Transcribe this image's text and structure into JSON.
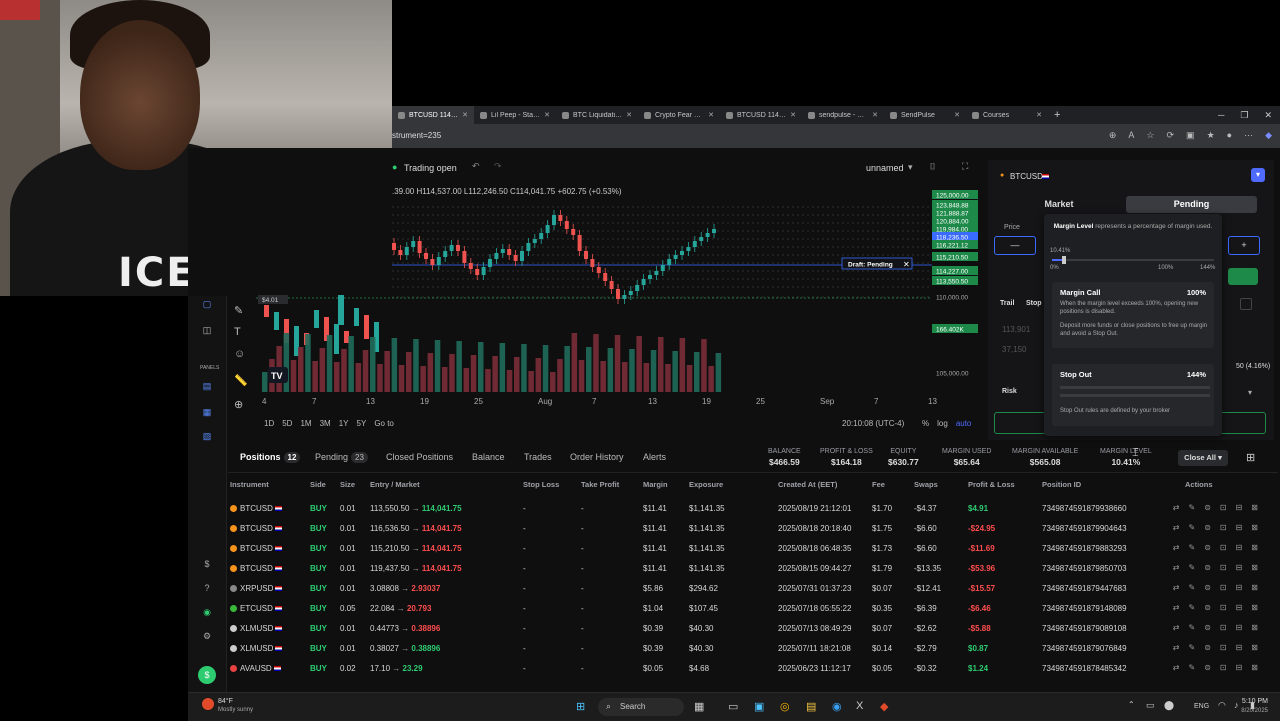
{
  "browser": {
    "tabs": [
      {
        "label": "BTCUSD 114,041.75",
        "active": true
      },
      {
        "label": "Lil Peep - Star Shopping"
      },
      {
        "label": "BTC Liquidation Levels"
      },
      {
        "label": "Crypto Fear & Greed"
      },
      {
        "label": "BTCUSD 114,147"
      },
      {
        "label": "sendpulse - Search"
      },
      {
        "label": "SendPulse"
      },
      {
        "label": "Courses"
      }
    ],
    "new_tab": "+",
    "url": "strument=235"
  },
  "chart": {
    "status": "Trading open",
    "layout_name": "unnamed",
    "ohlc": ".39.00 H114,537.00 L112,246.50 C114,041.75 +602.75 (+0.53%)",
    "draft_label": "Draft: Pending",
    "price_labels": [
      "125,000.00",
      "123,848.88",
      "121,888.87",
      "120,884.00",
      "119,984.00",
      "118,236.50",
      "116,221.12",
      "115,210.50",
      "114,227.00",
      "113,550.50",
      "110,000.00",
      "166.402K",
      "105,000.00"
    ],
    "small_tag": "$4.01",
    "x_labels": [
      "4",
      "7",
      "13",
      "19",
      "25",
      "Aug",
      "7",
      "13",
      "19",
      "25",
      "Sep",
      "7",
      "13"
    ],
    "periods": [
      "1D",
      "5D",
      "1M",
      "3M",
      "1Y",
      "5Y",
      "Go to"
    ],
    "clock": "20:10:08 (UTC-4)",
    "scale_opts": [
      "%",
      "log",
      "auto"
    ]
  },
  "chart_data": {
    "type": "candlestick",
    "title": "BTCUSD",
    "ylim": [
      103000,
      127000
    ],
    "volume_label": "166.402K"
  },
  "order_panel": {
    "symbol": "BTCUSD",
    "market_label": "Market",
    "pending_label": "Pending",
    "price_label": "Price",
    "minus": "—",
    "plus": "+",
    "trail_label": "Trail",
    "stop_label": "Stop",
    "value1": "113,901",
    "value2": "37,150",
    "risk_label": "Risk",
    "side_value": "50 (4.16%)"
  },
  "tooltip": {
    "title": "Margin Level",
    "desc": " represents a percentage of margin used.",
    "current": "10.41%",
    "scale": [
      "0%",
      "100%",
      "144%"
    ],
    "margin_call": {
      "title": "Margin Call",
      "pct": "100%",
      "text": "When the margin level exceeds 100%, opening new positions is disabled.",
      "text2": "Deposit more funds or close positions to free up margin and avoid a Stop Out."
    },
    "stop_out": {
      "title": "Stop Out",
      "pct": "144%",
      "text": "Stop Out rules are defined by your broker"
    }
  },
  "bottom": {
    "tabs": [
      {
        "label": "Positions",
        "count": "12"
      },
      {
        "label": "Pending",
        "count": "23"
      },
      {
        "label": "Closed Positions"
      },
      {
        "label": "Balance"
      },
      {
        "label": "Trades"
      },
      {
        "label": "Order History"
      },
      {
        "label": "Alerts"
      }
    ],
    "stats": [
      {
        "label": "BALANCE",
        "value": "$466.59"
      },
      {
        "label": "PROFIT & LOSS",
        "value": "$164.18"
      },
      {
        "label": "EQUITY",
        "value": "$630.77"
      },
      {
        "label": "MARGIN USED",
        "value": "$65.64"
      },
      {
        "label": "MARGIN AVAILABLE",
        "value": "$565.08"
      },
      {
        "label": "MARGIN LEVEL",
        "value": "10.41%"
      }
    ],
    "close_all": "Close All",
    "headers": [
      "Instrument",
      "Side",
      "Size",
      "Entry / Market",
      "Stop Loss",
      "Take Profit",
      "Margin",
      "Exposure",
      "Created At (EET)",
      "Fee",
      "Swaps",
      "Profit & Loss",
      "Position ID",
      "Actions"
    ],
    "rows": [
      {
        "inst": "BTCUSD",
        "coin": "#f7931a",
        "side": "BUY",
        "size": "0.01",
        "entry": "113,550.50",
        "market": "114,041.75",
        "sl": "-",
        "tp": "-",
        "margin": "$11.41",
        "exp": "$1,141.35",
        "created": "2025/08/19 21:12:01",
        "fee": "$1.70",
        "swaps": "-$4.37",
        "pl": "$4.91",
        "plc": "pos",
        "id": "7349874591879938660"
      },
      {
        "inst": "BTCUSD",
        "coin": "#f7931a",
        "side": "BUY",
        "size": "0.01",
        "entry": "116,536.50",
        "market": "114,041.75",
        "sl": "-",
        "tp": "-",
        "margin": "$11.41",
        "exp": "$1,141.35",
        "created": "2025/08/18 20:18:40",
        "fee": "$1.75",
        "swaps": "-$6.60",
        "pl": "-$24.95",
        "plc": "neg",
        "id": "7349874591879904643"
      },
      {
        "inst": "BTCUSD",
        "coin": "#f7931a",
        "side": "BUY",
        "size": "0.01",
        "entry": "115,210.50",
        "market": "114,041.75",
        "sl": "-",
        "tp": "-",
        "margin": "$11.41",
        "exp": "$1,141.35",
        "created": "2025/08/18 06:48:35",
        "fee": "$1.73",
        "swaps": "-$6.60",
        "pl": "-$11.69",
        "plc": "neg",
        "id": "7349874591879883293"
      },
      {
        "inst": "BTCUSD",
        "coin": "#f7931a",
        "side": "BUY",
        "size": "0.01",
        "entry": "119,437.50",
        "market": "114,041.75",
        "sl": "-",
        "tp": "-",
        "margin": "$11.41",
        "exp": "$1,141.35",
        "created": "2025/08/15 09:44:27",
        "fee": "$1.79",
        "swaps": "-$13.35",
        "pl": "-$53.96",
        "plc": "neg",
        "id": "7349874591879850703"
      },
      {
        "inst": "XRPUSD",
        "coin": "#888888",
        "side": "BUY",
        "size": "0.01",
        "entry": "3.08808",
        "market": "2.93037",
        "sl": "-",
        "tp": "-",
        "margin": "$5.86",
        "exp": "$294.62",
        "created": "2025/07/31 01:37:23",
        "fee": "$0.07",
        "swaps": "-$12.41",
        "pl": "-$15.57",
        "plc": "neg",
        "id": "7349874591879447683"
      },
      {
        "inst": "ETCUSD",
        "coin": "#3ab83a",
        "side": "BUY",
        "size": "0.05",
        "entry": "22.084",
        "market": "20.793",
        "sl": "-",
        "tp": "-",
        "margin": "$1.04",
        "exp": "$107.45",
        "created": "2025/07/18 05:55:22",
        "fee": "$0.35",
        "swaps": "-$6.39",
        "pl": "-$6.46",
        "plc": "neg",
        "id": "7349874591879148089"
      },
      {
        "inst": "XLMUSD",
        "coin": "#cccccc",
        "side": "BUY",
        "size": "0.01",
        "entry": "0.44773",
        "market": "0.38896",
        "sl": "-",
        "tp": "-",
        "margin": "$0.39",
        "exp": "$40.30",
        "created": "2025/07/13 08:49:29",
        "fee": "$0.07",
        "swaps": "-$2.62",
        "pl": "-$5.88",
        "plc": "neg",
        "id": "7349874591879089108"
      },
      {
        "inst": "XLMUSD",
        "coin": "#cccccc",
        "side": "BUY",
        "size": "0.01",
        "entry": "0.38027",
        "market": "0.38896",
        "sl": "-",
        "tp": "-",
        "margin": "$0.39",
        "exp": "$40.30",
        "created": "2025/07/11 18:21:08",
        "fee": "$0.14",
        "swaps": "-$2.79",
        "pl": "$0.87",
        "plc": "pos",
        "id": "7349874591879076849"
      },
      {
        "inst": "AVAUSD",
        "coin": "#e84142",
        "side": "BUY",
        "size": "0.02",
        "entry": "17.10",
        "market": "23.29",
        "sl": "-",
        "tp": "-",
        "margin": "$0.05",
        "exp": "$4.68",
        "created": "2025/06/23 11:12:17",
        "fee": "$0.05",
        "swaps": "-$0.32",
        "pl": "$1.24",
        "plc": "pos",
        "id": "7349874591878485342"
      }
    ]
  },
  "taskbar": {
    "weather": "84°F",
    "weather_sub": "Mostly sunny",
    "search": "Search",
    "lang": "ENG",
    "time": "5:10 PM",
    "date": "8/20/2025"
  },
  "webcam": {
    "shirt_text": "ICE"
  }
}
